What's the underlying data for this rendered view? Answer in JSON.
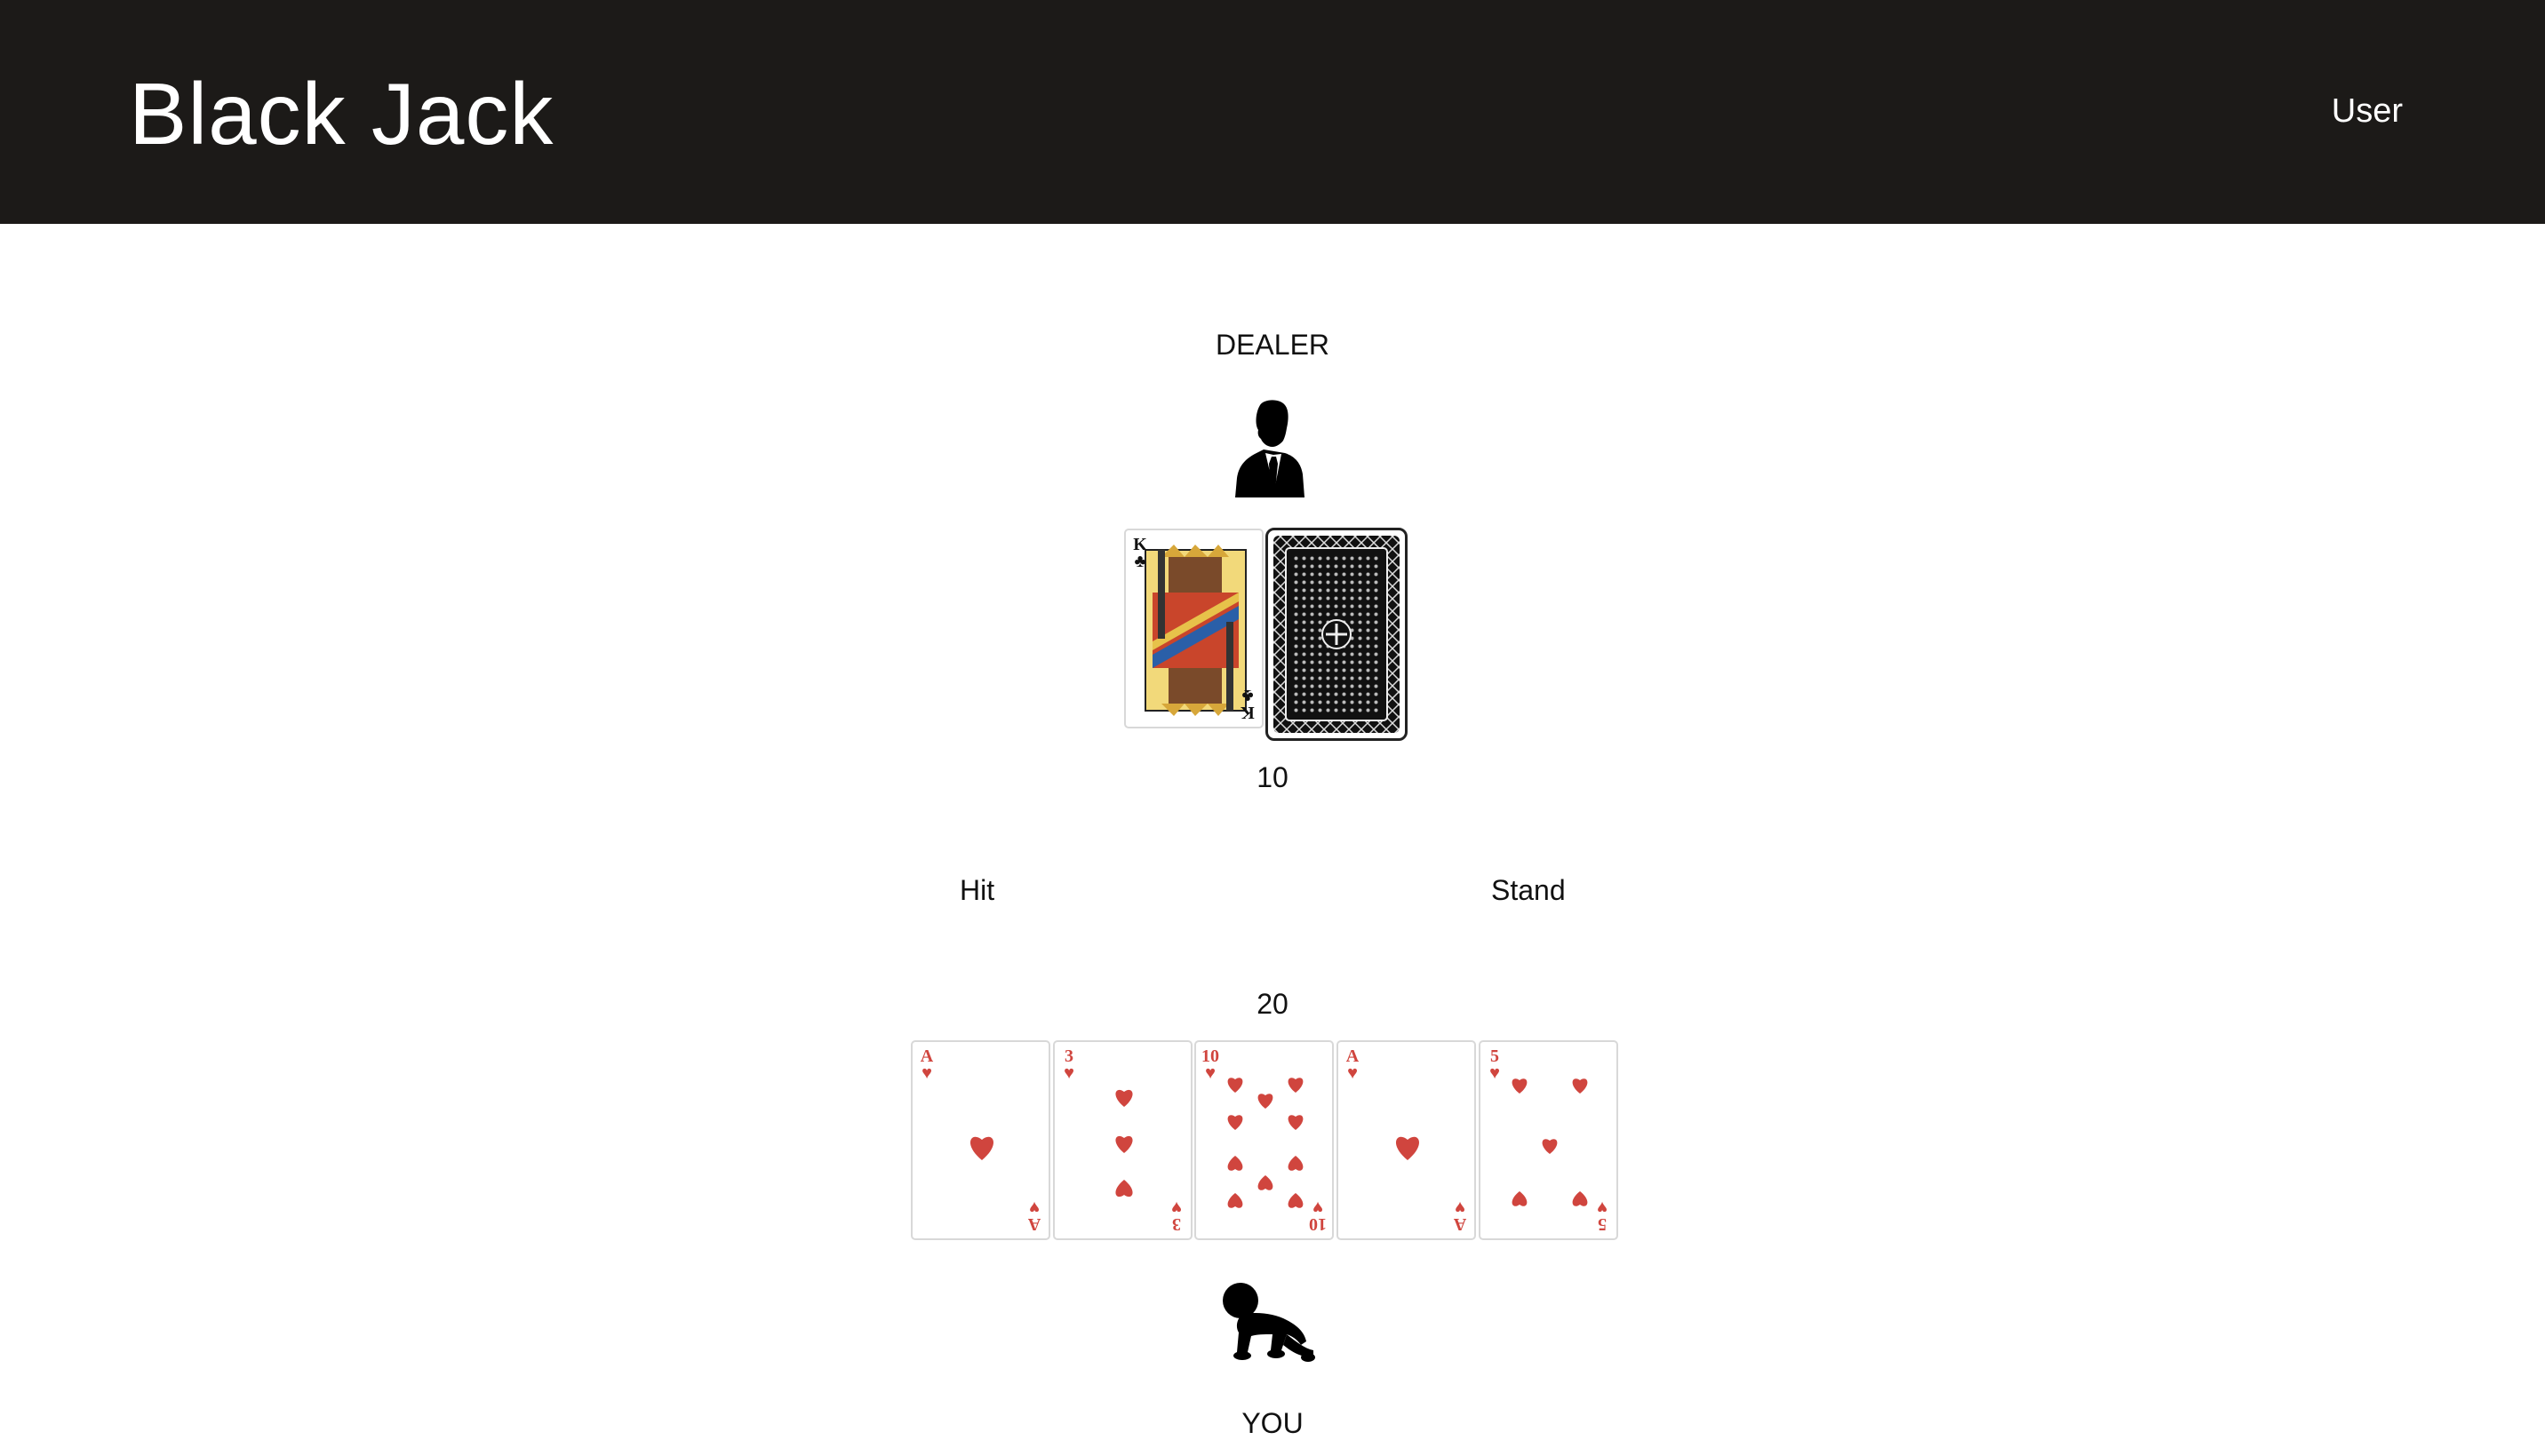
{
  "header": {
    "title": "Black Jack",
    "user_link": "User"
  },
  "dealer": {
    "label": "DEALER",
    "avatar_icon": "businessman-silhouette-icon",
    "score": "10",
    "cards": [
      {
        "rank": "K",
        "suit": "♣",
        "color": "#111111",
        "face_down": false
      },
      {
        "face_down": true
      }
    ]
  },
  "actions": {
    "hit_label": "Hit",
    "stand_label": "Stand"
  },
  "player": {
    "label": "YOU",
    "avatar_icon": "crawling-baby-silhouette-icon",
    "score": "20",
    "cards": [
      {
        "rank": "A",
        "suit": "♥",
        "color": "#d0453e"
      },
      {
        "rank": "3",
        "suit": "♥",
        "color": "#d0453e"
      },
      {
        "rank": "10",
        "suit": "♥",
        "color": "#d0453e"
      },
      {
        "rank": "A",
        "suit": "♥",
        "color": "#d0453e"
      },
      {
        "rank": "5",
        "suit": "♥",
        "color": "#d0453e"
      }
    ]
  }
}
